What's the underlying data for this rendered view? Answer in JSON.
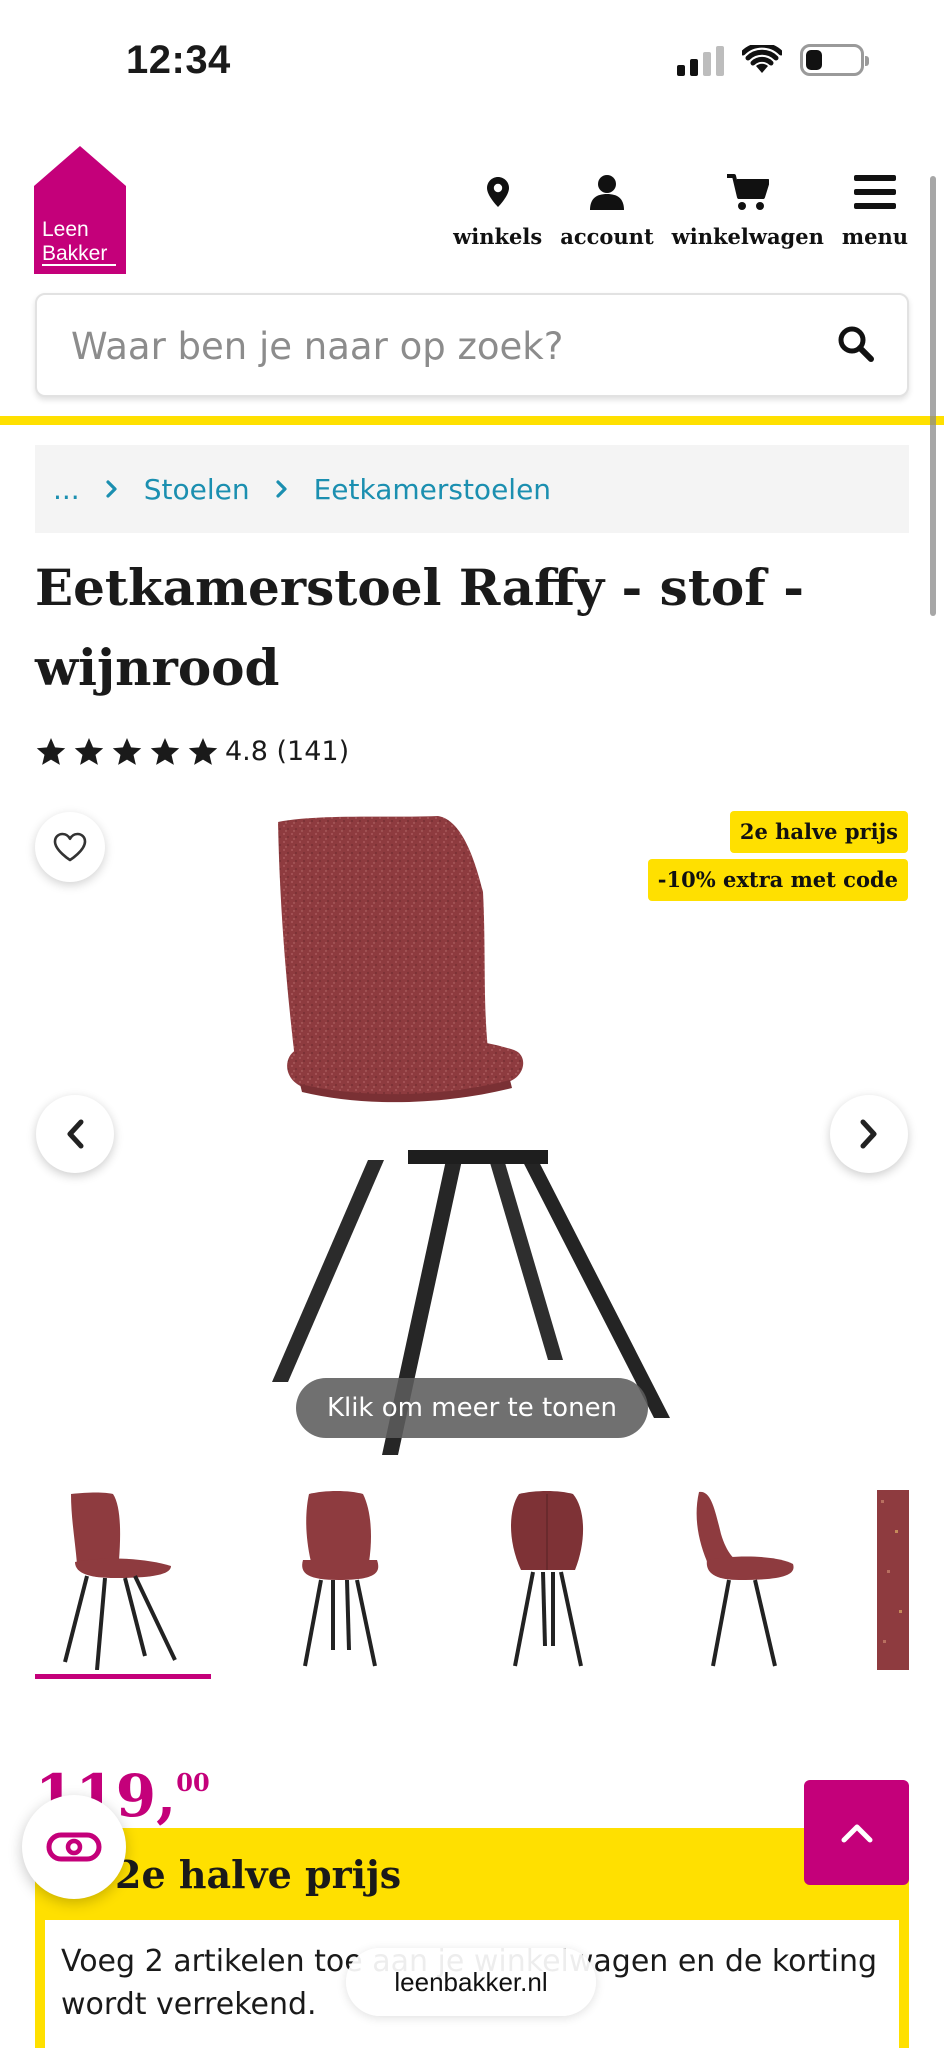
{
  "status_bar": {
    "time": "12:34"
  },
  "header": {
    "logo_line1": "Leen",
    "logo_line2": "Bakker",
    "nav": [
      {
        "label": "winkels",
        "icon": "location-pin-icon"
      },
      {
        "label": "account",
        "icon": "user-icon"
      },
      {
        "label": "winkelwagen",
        "icon": "cart-icon"
      },
      {
        "label": "menu",
        "icon": "hamburger-menu-icon"
      }
    ]
  },
  "search": {
    "placeholder": "Waar ben je naar op zoek?"
  },
  "breadcrumb": {
    "ellipsis": "...",
    "items": [
      "Stoelen",
      "Eetkamerstoelen"
    ]
  },
  "product": {
    "title": "Eetkamerstoel Raffy - stof - wijnrood",
    "rating_text": "4.8 (141)",
    "rating": 4.8,
    "badges": [
      "2e halve prijs",
      "-10% extra met code"
    ],
    "more_button": "Klik om meer te tonen",
    "color": "#8e3b3f",
    "thumbnail_count": 5,
    "selected_thumbnail": 1
  },
  "price": {
    "euros": "119,",
    "cents": "00"
  },
  "promo": {
    "title": "2e halve prijs",
    "text": "Voeg 2 artikelen toe aan je winkelwagen en de korting wordt verrekend."
  },
  "browser": {
    "url": "leenbakker.nl"
  },
  "colors": {
    "brand": "#c4007a",
    "accent_yellow": "#ffe000",
    "link": "#1b8fb0"
  }
}
